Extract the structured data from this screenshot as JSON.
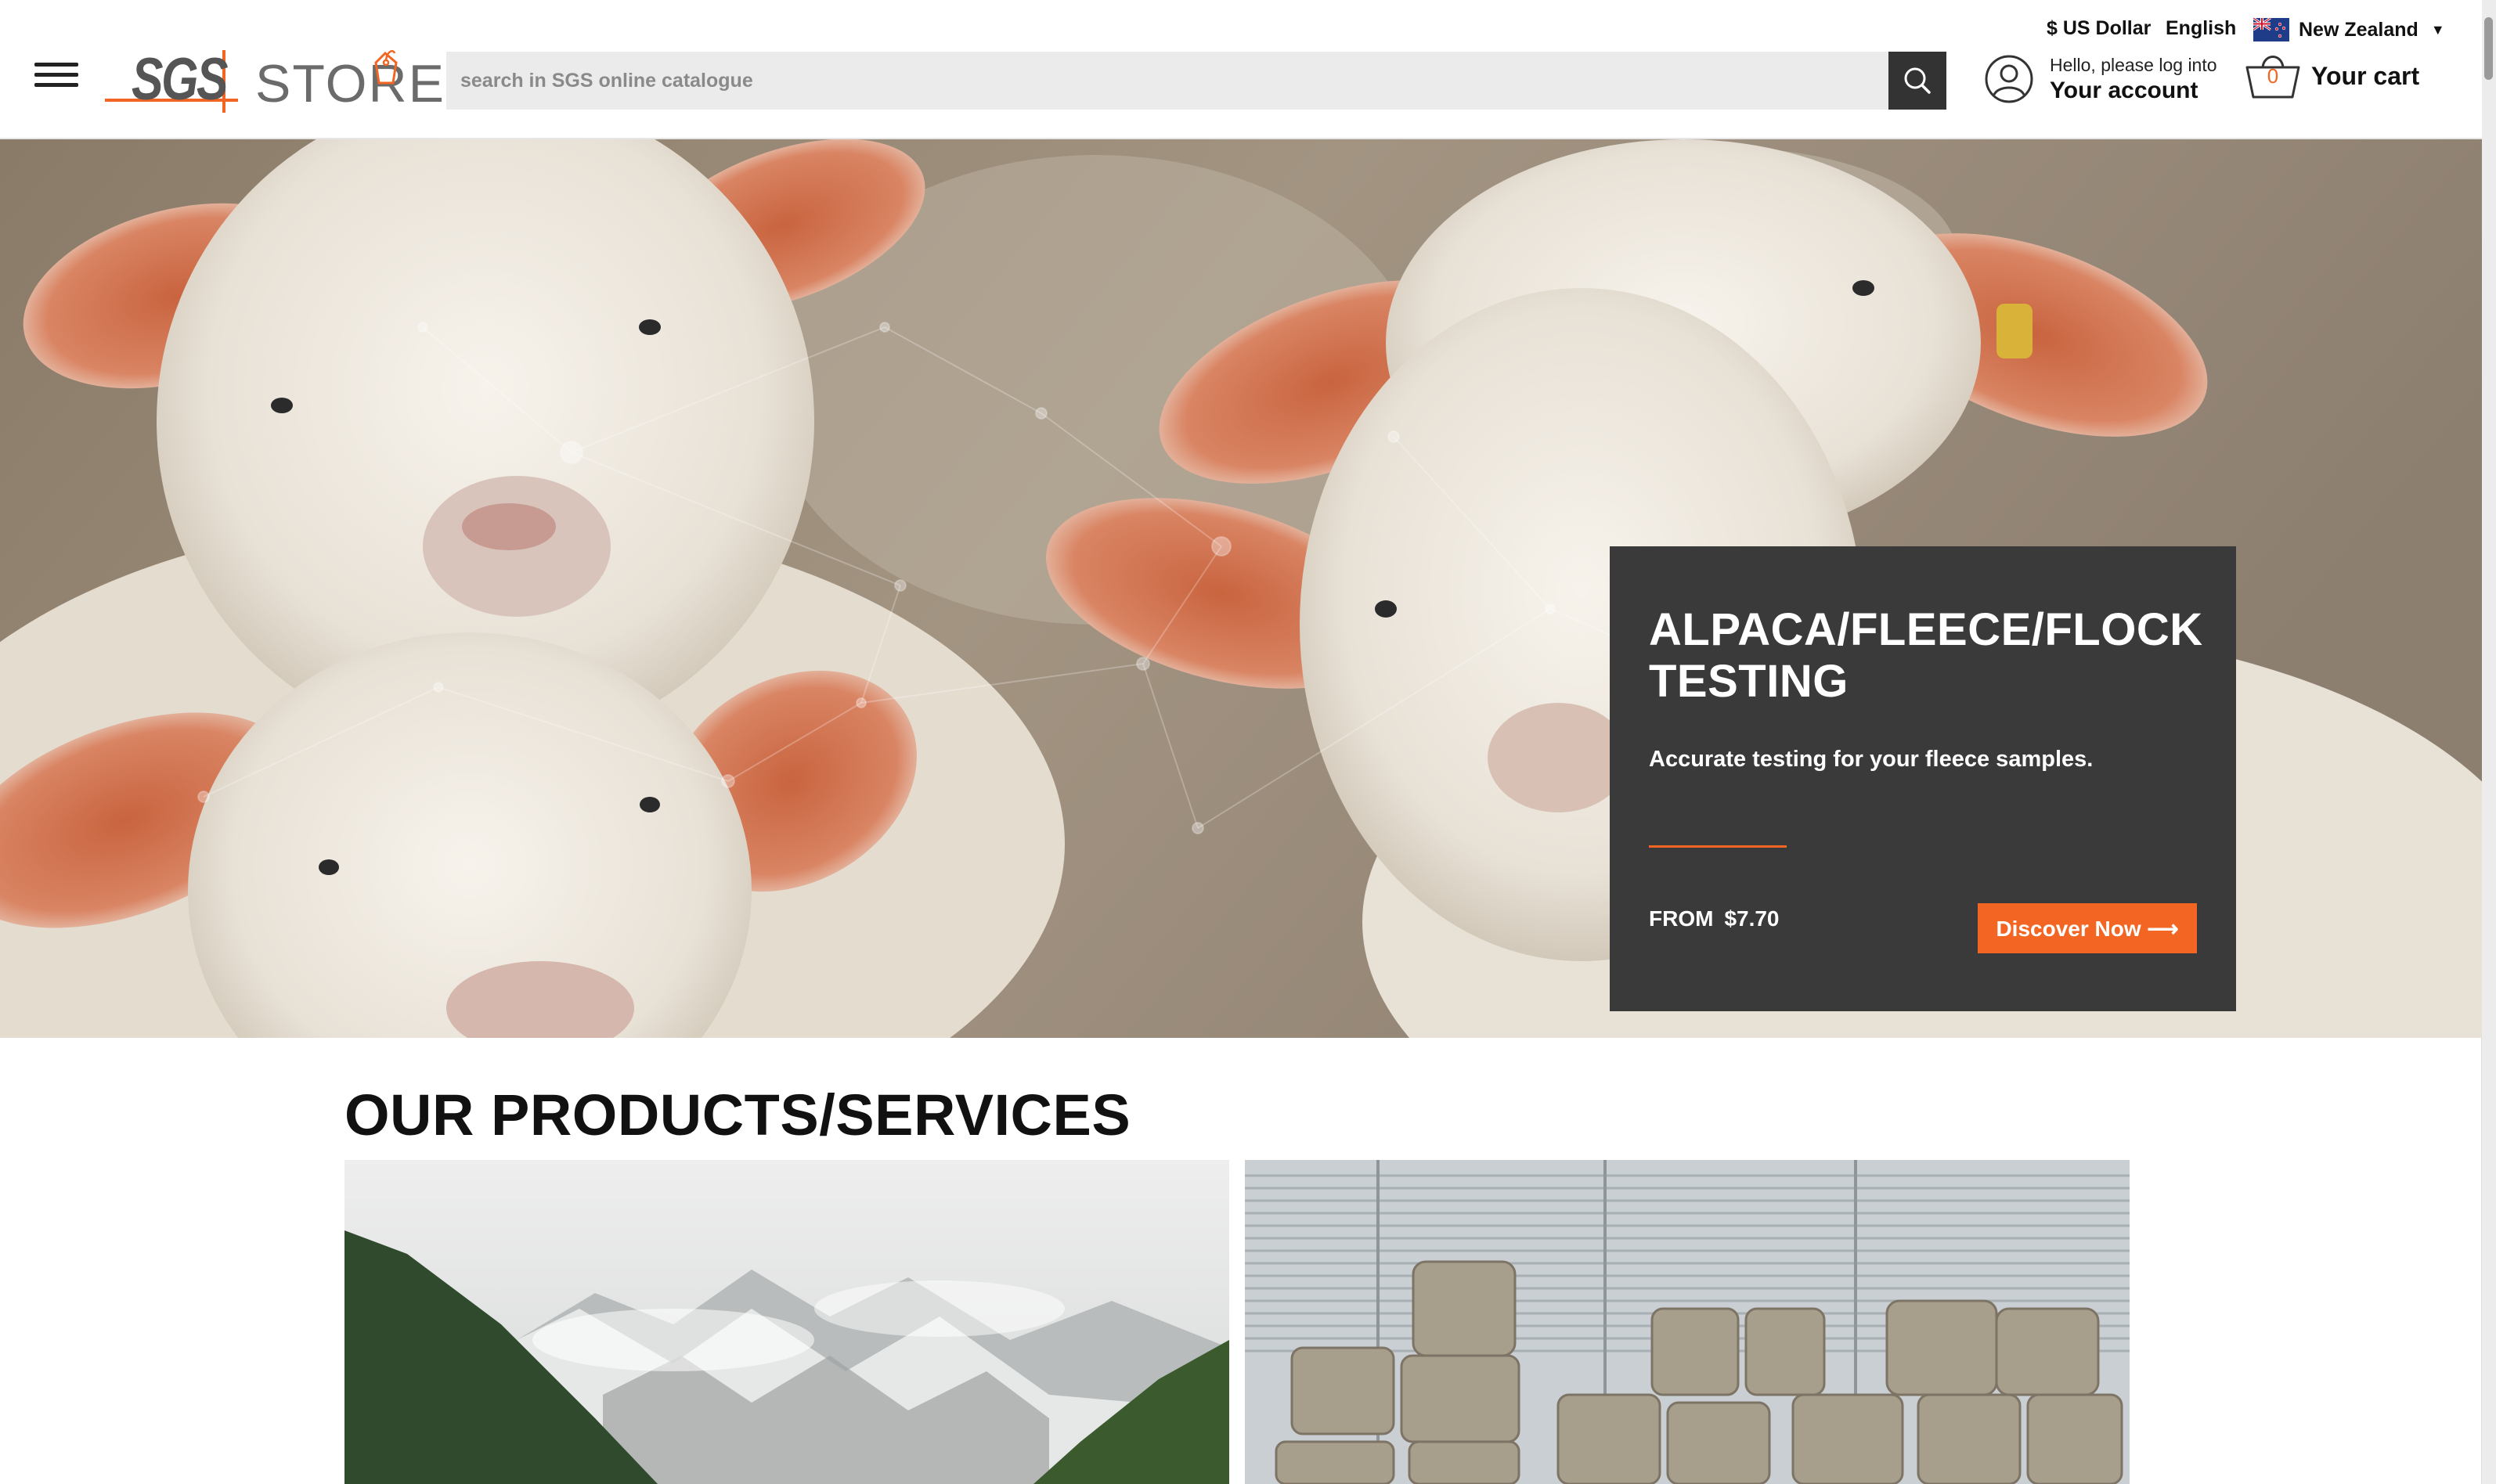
{
  "header": {
    "logo_sgs": "SGS",
    "logo_store": "STORE",
    "search_placeholder": "search in SGS online catalogue",
    "currency": "$ US Dollar",
    "language": "English",
    "country": "New Zealand",
    "account_small": "Hello, please log into",
    "account_big": "Your account",
    "cart_count": "0",
    "cart_label": "Your cart"
  },
  "hero": {
    "title": "ALPACA/FLEECE/FLOCK TESTING",
    "description": "Accurate testing for your fleece samples.",
    "from_label": "FROM",
    "price": "$7.70",
    "cta": "Discover Now ⟶"
  },
  "products": {
    "title": "OUR PRODUCTS/SERVICES"
  },
  "colors": {
    "accent": "#f26522",
    "promo_bg": "#3a3a3a",
    "search_bg": "#ebebeb"
  },
  "icons": [
    "menu-icon",
    "search-icon",
    "user-icon",
    "basket-icon",
    "nz-flag-icon",
    "chevron-down-icon"
  ]
}
